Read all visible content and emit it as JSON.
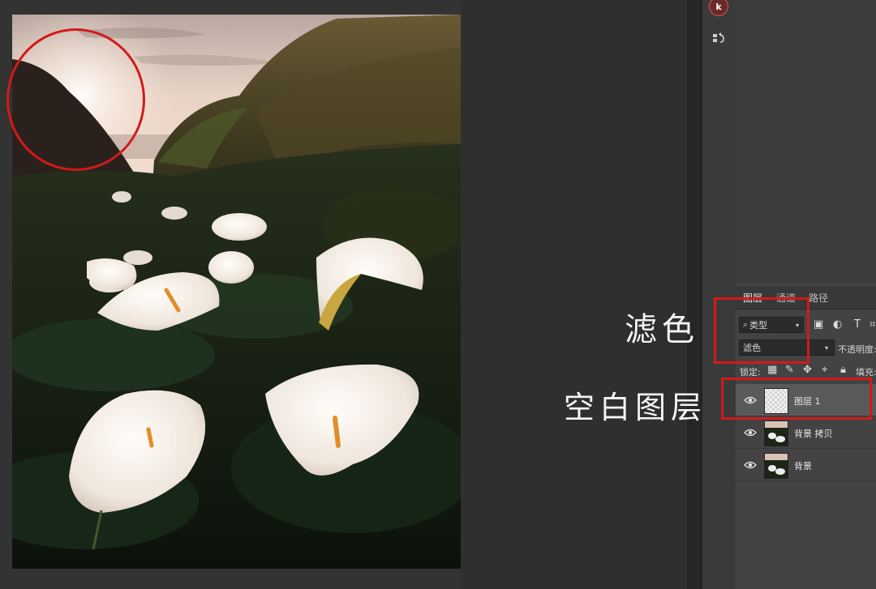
{
  "annotations": {
    "blend_mode_note": "滤色",
    "blank_layer_note": "空白图层"
  },
  "layers_panel": {
    "tabs": [
      "图层",
      "通道",
      "路径"
    ],
    "filter_kind": "类型",
    "blend_mode": "滤色",
    "opacity_label": "不透明度:",
    "lock_label": "锁定:",
    "fill_label": "填充:",
    "layers": [
      {
        "name": "图层 1",
        "selected": true
      },
      {
        "name": "背景 拷贝",
        "selected": false
      },
      {
        "name": "背景",
        "selected": false
      }
    ]
  },
  "dock": {
    "extension_badge": "k"
  },
  "colors": {
    "annotation_red": "#d11a1a",
    "canvas_bg": "#333333",
    "panel_bg": "#434343",
    "selected_layer": "#5a5a5a"
  }
}
